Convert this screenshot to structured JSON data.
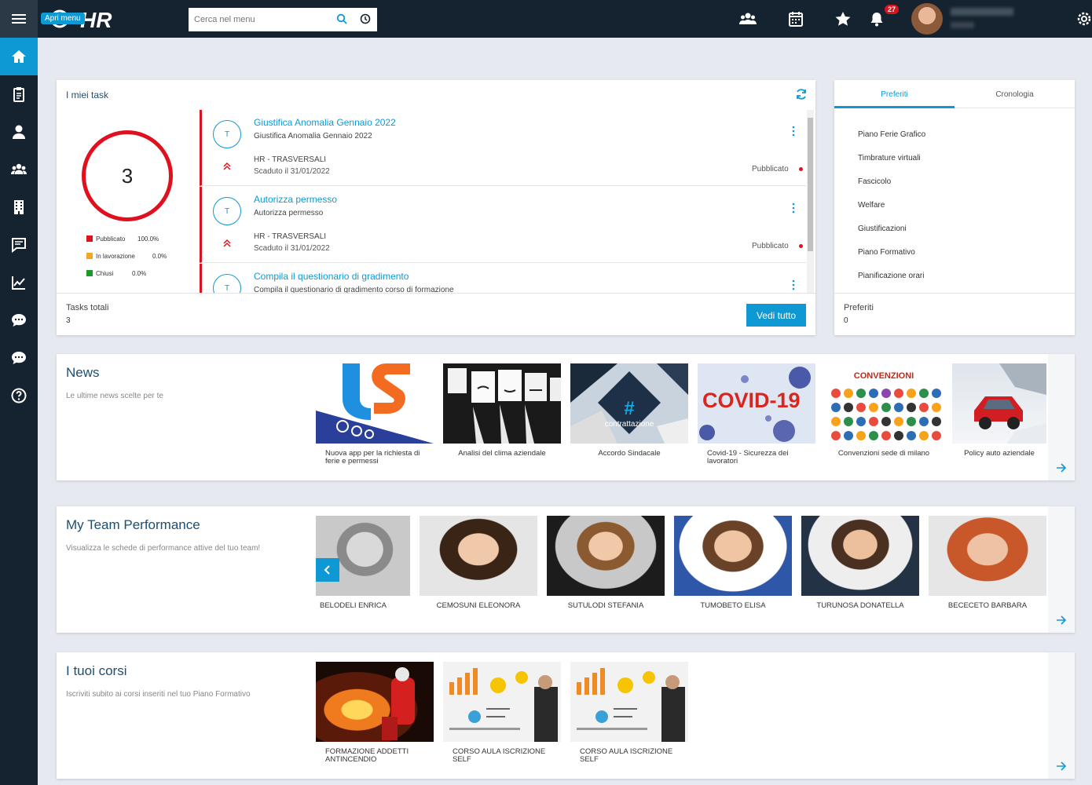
{
  "header": {
    "menu_tooltip": "Apri menu",
    "logo_text": "HR",
    "search_placeholder": "Cerca nel menu",
    "notifications_count": "27"
  },
  "sidebar": {
    "items": [
      "home-icon",
      "clipboard-icon",
      "user-icon",
      "users-icon",
      "building-icon",
      "feedback-icon",
      "chart-icon",
      "chat-icon",
      "chat-alt-icon",
      "help-icon"
    ]
  },
  "tasks": {
    "title": "I miei task",
    "total": "3",
    "legend": [
      {
        "label": "Pubblicato",
        "pct": "100.0%",
        "color": "#e0101e"
      },
      {
        "label": "In lavorazione",
        "pct": "0.0%",
        "color": "#f5a623"
      },
      {
        "label": "Chiusi",
        "pct": "0.0%",
        "color": "#1a9a2b"
      }
    ],
    "items": [
      {
        "initial": "T",
        "name": "Giustifica Anomalia Gennaio 2022",
        "desc": "Giustifica Anomalia Gennaio 2022",
        "category": "HR - TRASVERSALI",
        "due": "Scaduto il 31/01/2022",
        "status": "Pubblicato"
      },
      {
        "initial": "T",
        "name": "Autorizza permesso",
        "desc": "Autorizza permesso",
        "category": "HR - TRASVERSALI",
        "due": "Scaduto il 31/01/2022",
        "status": "Pubblicato"
      },
      {
        "initial": "T",
        "name": "Compila il questionario di gradimento",
        "desc": "Compila il questionario di gradimento corso di formazione",
        "category": "",
        "due": "",
        "status": ""
      }
    ],
    "footer_label": "Tasks totali",
    "footer_value": "3",
    "button_label": "Vedi tutto"
  },
  "favorites": {
    "tab_active": "Preferiti",
    "tab_inactive": "Cronologia",
    "items": [
      "Piano Ferie Grafico",
      "Timbrature virtuali",
      "Fascicolo",
      "Welfare",
      "Giustificazioni",
      "Piano Formativo",
      "Pianificazione orari"
    ],
    "footer_label": "Preferiti",
    "footer_value": "0"
  },
  "news": {
    "title": "News",
    "subtitle": "Le ultime news scelte per te",
    "items": [
      {
        "caption": "Nuova app per la richiesta di ferie e permessi"
      },
      {
        "caption": "Analisi del clima aziendale"
      },
      {
        "caption": "Accordo Sindacale",
        "img_text": "contrattazione"
      },
      {
        "caption": "Covid-19 - Sicurezza dei lavoratori",
        "img_text": "COVID-19"
      },
      {
        "caption": "Convenzioni sede di milano",
        "img_text": "CONVENZIONI"
      },
      {
        "caption": "Policy auto aziendale"
      }
    ]
  },
  "team": {
    "title": "My Team Performance",
    "subtitle": "Visualizza le schede di performance attive del tuo team!",
    "members": [
      "BELODELI ENRICA",
      "CEMOSUNI ELEONORA",
      "SUTULODI STEFANIA",
      "TUMOBETO ELISA",
      "TURUNOSA DONATELLA",
      "BECECETO BARBARA"
    ]
  },
  "courses": {
    "title": "I tuoi corsi",
    "subtitle": "Iscriviti subito ai corsi inseriti nel tuo Piano Formativo",
    "items": [
      "FORMAZIONE ADDETTI ANTINCENDIO",
      "CORSO AULA ISCRIZIONE SELF",
      "CORSO AULA ISCRIZIONE SELF"
    ]
  }
}
